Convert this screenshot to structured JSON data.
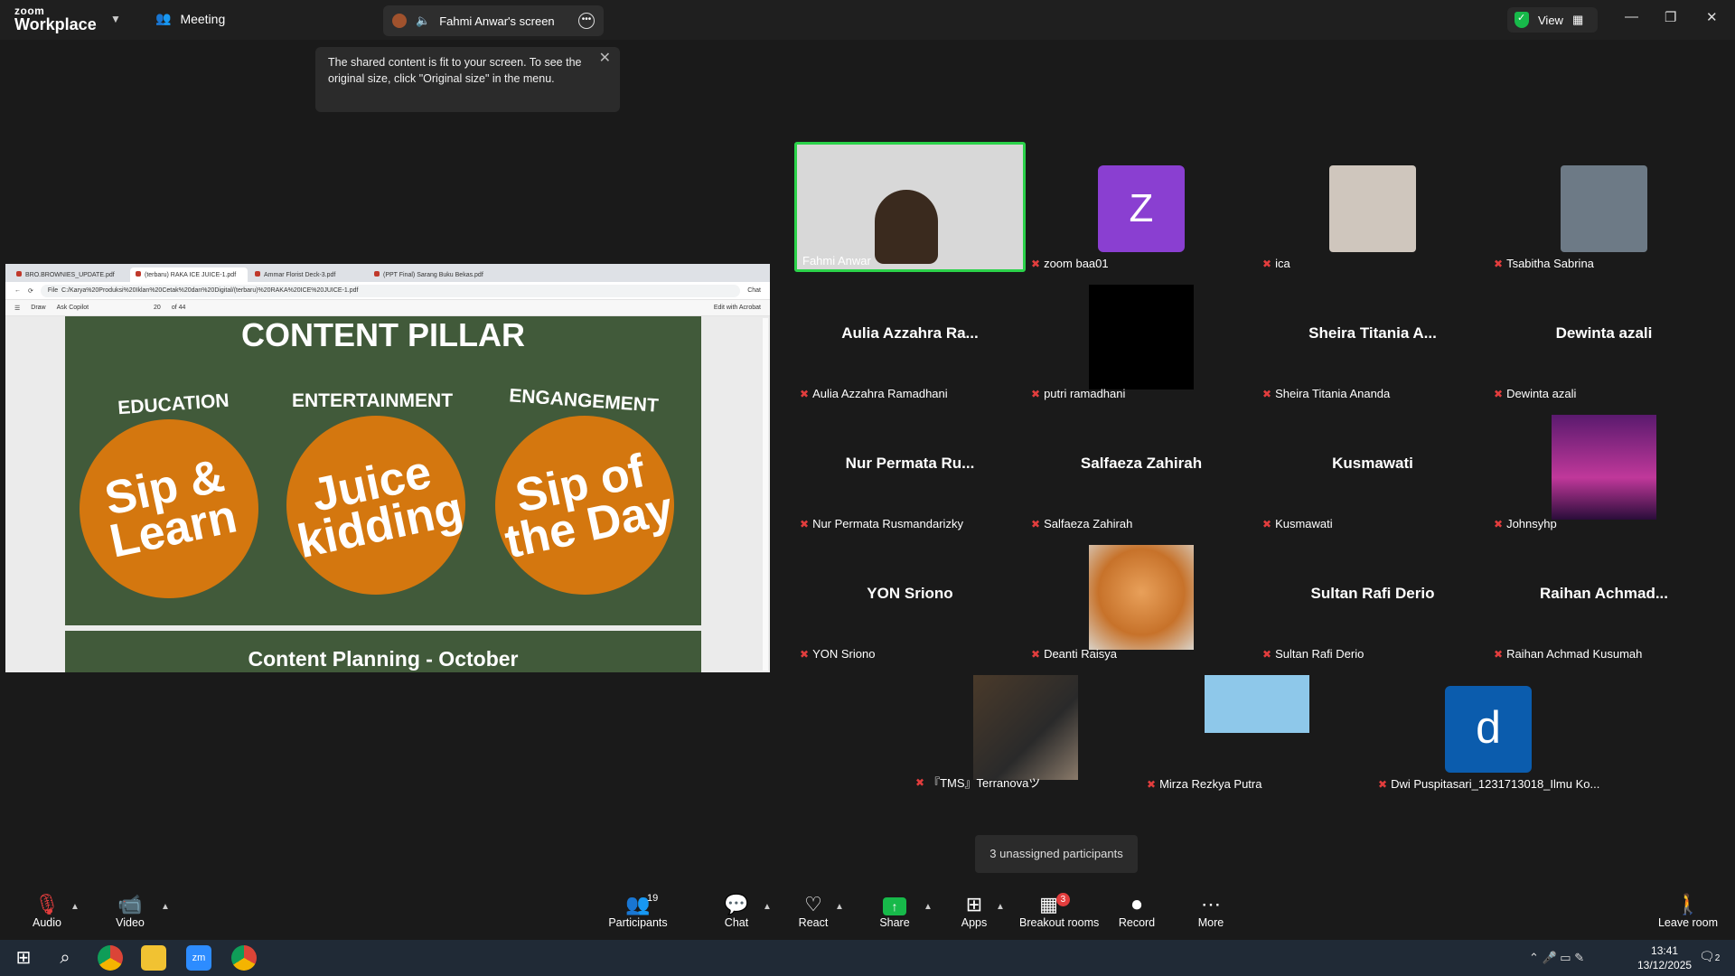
{
  "app": {
    "brand_line1": "zoom",
    "brand_line2": "Workplace"
  },
  "titlebar": {
    "meeting_label": "Meeting",
    "share_label": "Fahmi Anwar's screen",
    "view_label": "View"
  },
  "tooltip": {
    "text": "The shared content is fit to your screen. To see the original size, click \"Original size\" in the menu."
  },
  "browser": {
    "tabs": [
      "BRO.BROWNIES_UPDATE.pdf",
      "(terbaru) RAKA ICE JUICE-1.pdf",
      "Ammar Florist Deck-3.pdf",
      "(PPT Final) Sarang Buku Bekas.pdf"
    ],
    "address_prefix": "File",
    "url": "C:/Karya%20Produksi%20Iklan%20Cetak%20dan%20Digital/(terbaru)%20RAKA%20ICE%20JUICE-1.pdf",
    "chat_label": "Chat",
    "toolbar": {
      "draw": "Draw",
      "copilot": "Ask Copilot",
      "page": "20",
      "of": "of 44",
      "edit": "Edit with Acrobat"
    }
  },
  "slide": {
    "title": "CONTENT PILLAR",
    "pillars": [
      {
        "label": "EDUCATION",
        "circle": "Sip & Learn"
      },
      {
        "label": "ENTERTAINMENT",
        "circle": "Juice kidding"
      },
      {
        "label": "ENGANGEMENT",
        "circle": "Sip of the Day"
      }
    ],
    "next_title": "Content Planning - October"
  },
  "participants": [
    {
      "big": "",
      "label": "Fahmi Anwar",
      "muted": false
    },
    {
      "big": "Z",
      "label": "zoom baa01",
      "muted": true
    },
    {
      "big": "",
      "label": "ica",
      "muted": true
    },
    {
      "big": "",
      "label": "Tsabitha Sabrina",
      "muted": true
    },
    {
      "big": "Aulia Azzahra Ra...",
      "label": "Aulia Azzahra Ramadhani",
      "muted": true
    },
    {
      "big": "",
      "label": "putri ramadhani",
      "muted": true
    },
    {
      "big": "Sheira Titania A...",
      "label": "Sheira Titania Ananda",
      "muted": true
    },
    {
      "big": "Dewinta azali",
      "label": "Dewinta azali",
      "muted": true
    },
    {
      "big": "Nur Permata Ru...",
      "label": "Nur Permata Rusmandarizky",
      "muted": true
    },
    {
      "big": "Salfaeza Zahirah",
      "label": "Salfaeza Zahirah",
      "muted": true
    },
    {
      "big": "Kusmawati",
      "label": "Kusmawati",
      "muted": true
    },
    {
      "big": "",
      "label": "Johnsyhp",
      "muted": true
    },
    {
      "big": "YON Sriono",
      "label": "YON Sriono",
      "muted": true
    },
    {
      "big": "",
      "label": "Deanti Raisya",
      "muted": true
    },
    {
      "big": "Sultan Rafi Derio",
      "label": "Sultan Rafi Derio",
      "muted": true
    },
    {
      "big": "Raihan Achmad...",
      "label": "Raihan Achmad Kusumah",
      "muted": true
    },
    {
      "big": "",
      "label": "『TMS』Terranovaツ",
      "muted": true
    },
    {
      "big": "",
      "label": "Mirza Rezkya Putra",
      "muted": true
    },
    {
      "big": "d",
      "label": "Dwi Puspitasari_1231713018_Ilmu Ko...",
      "muted": true
    }
  ],
  "unassigned": "3 unassigned participants",
  "toolbar": {
    "audio": "Audio",
    "video": "Video",
    "participants": "Participants",
    "participants_count": "19",
    "chat": "Chat",
    "react": "React",
    "share": "Share",
    "apps": "Apps",
    "breakout": "Breakout rooms",
    "breakout_badge": "3",
    "record": "Record",
    "more": "More",
    "leave": "Leave room"
  },
  "taskbar": {
    "time": "13:41",
    "date": "13/12/2025",
    "notif": "2"
  },
  "colors": {
    "accent_green": "#2bd24a",
    "avatar_purple": "#8a3fd1",
    "avatar_blue": "#0b5cad",
    "slide_green": "#415a3a",
    "slide_orange": "#d4770f"
  }
}
